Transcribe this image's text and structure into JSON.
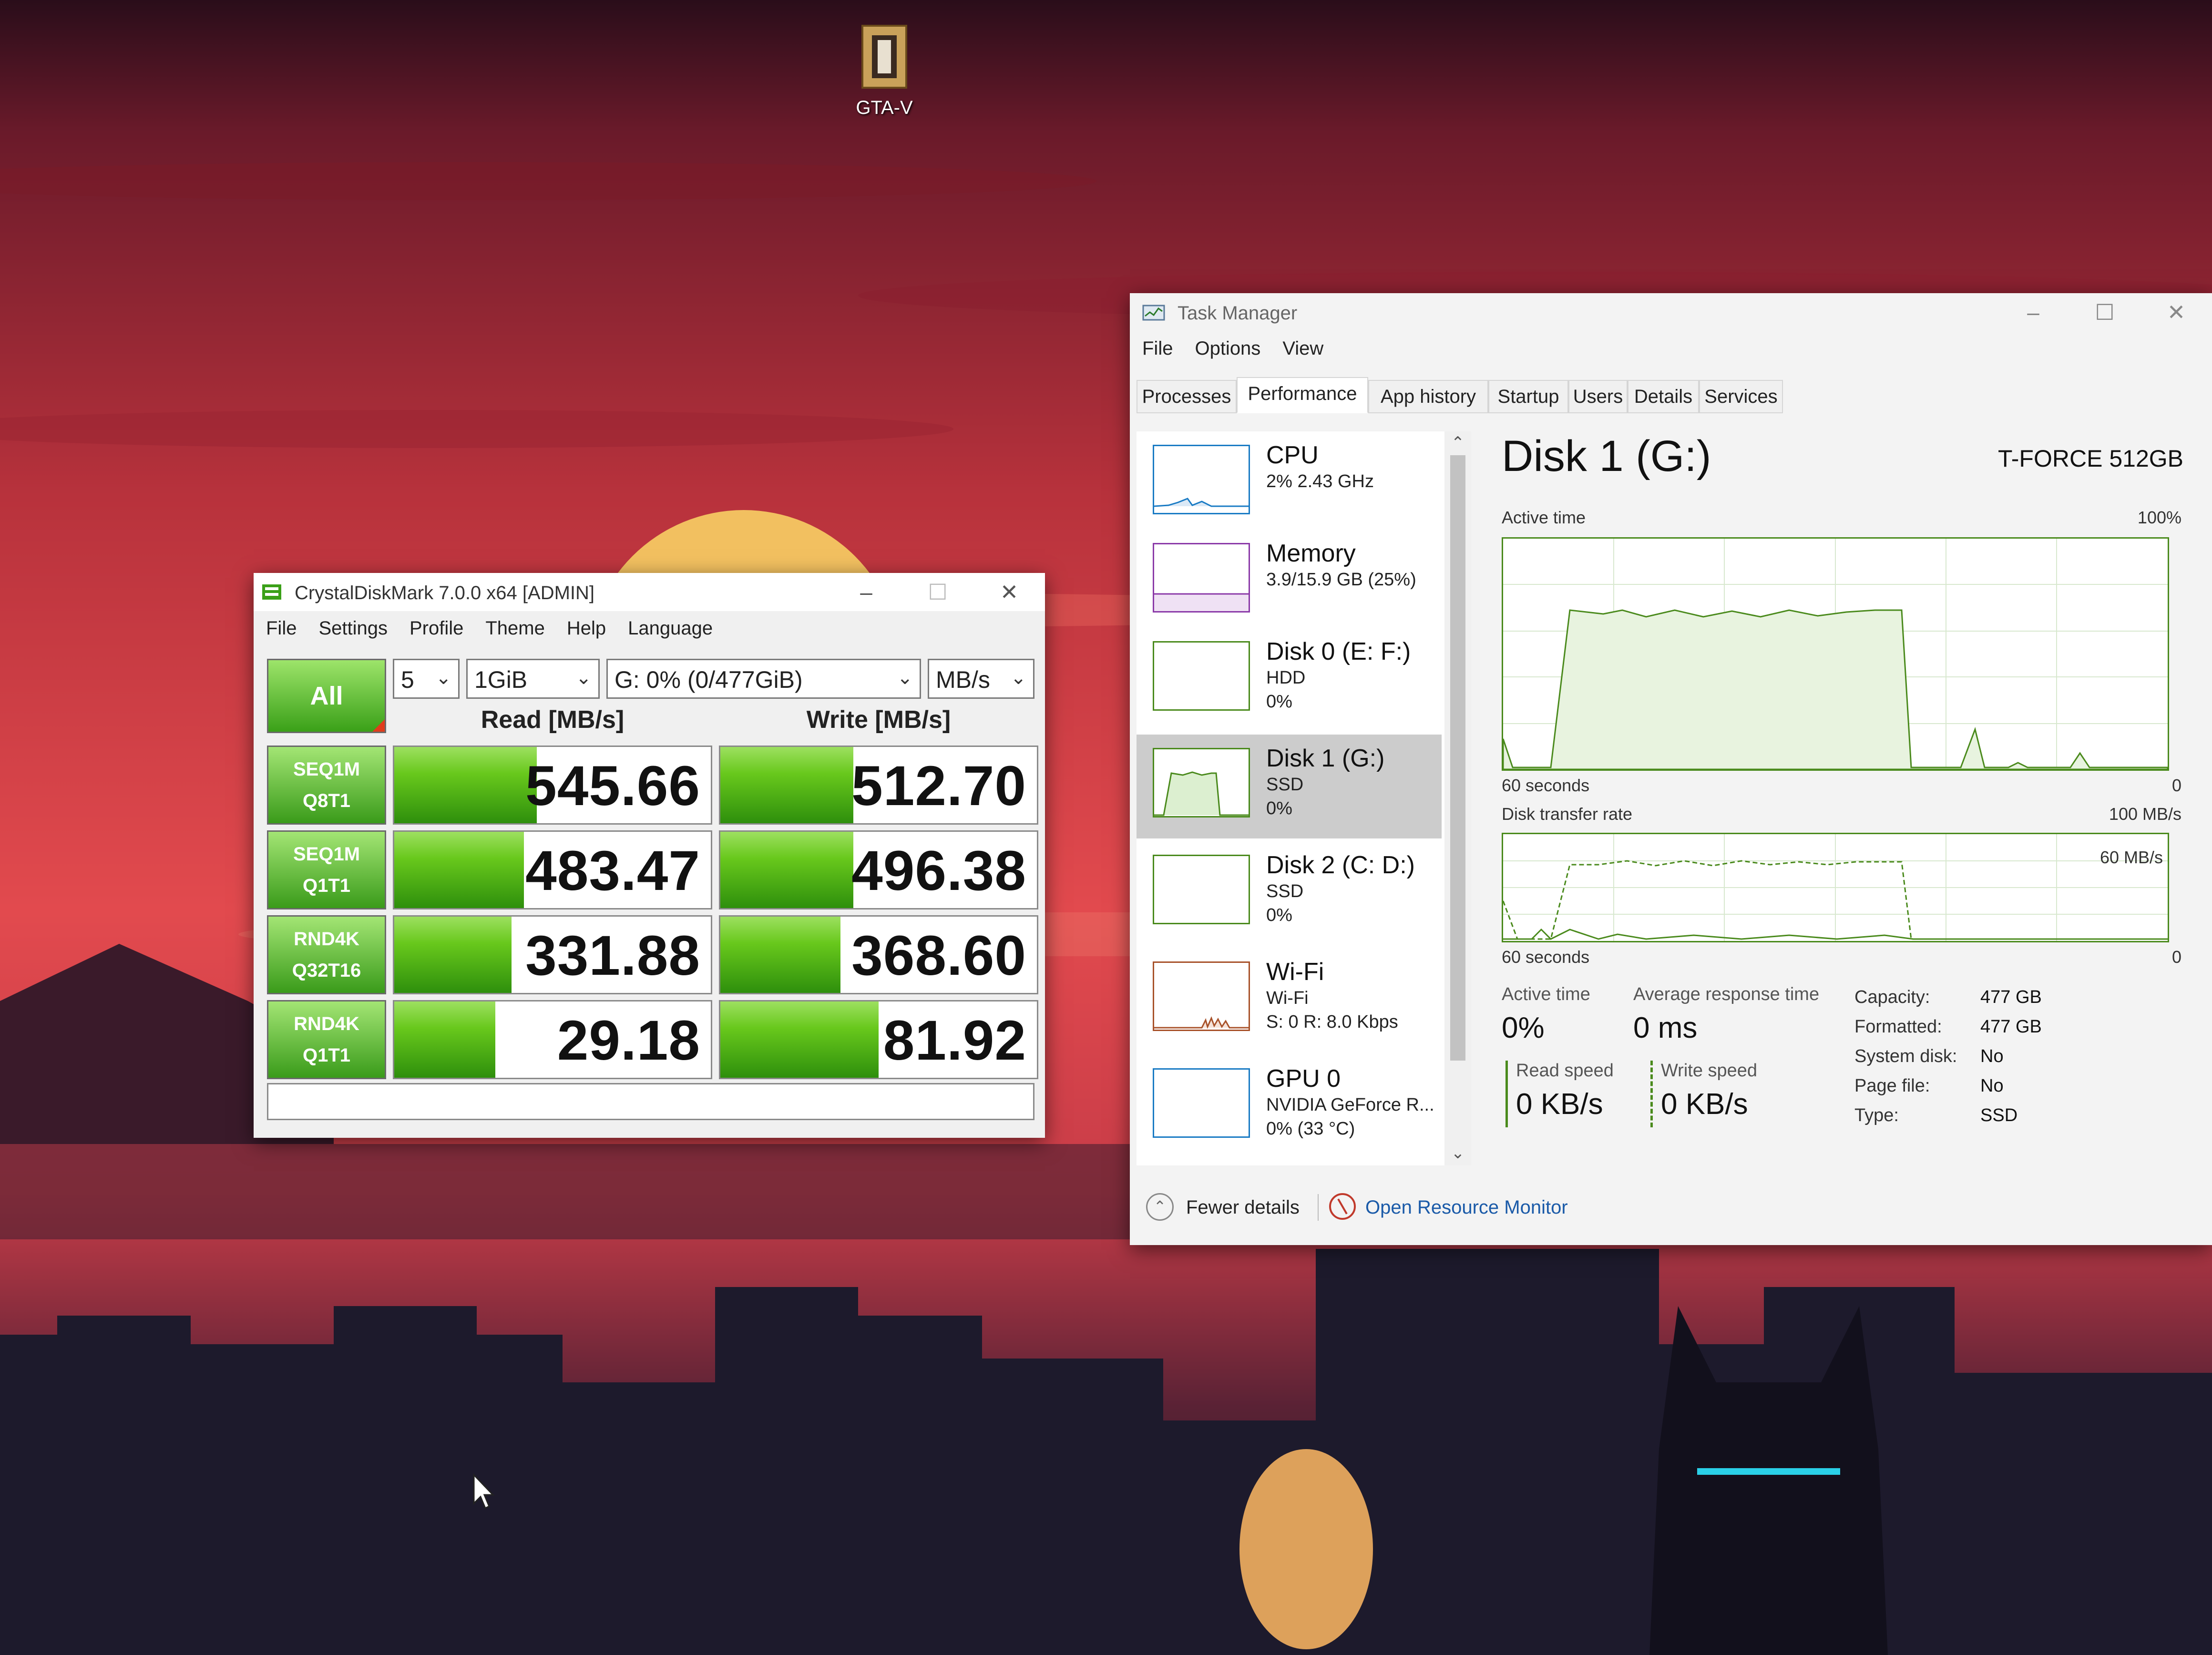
{
  "desktop": {
    "icon_label": "GTA-V"
  },
  "crystaldiskmark": {
    "title": "CrystalDiskMark 7.0.0 x64 [ADMIN]",
    "menu": [
      "File",
      "Settings",
      "Profile",
      "Theme",
      "Help",
      "Language"
    ],
    "all_button": "All",
    "count": "5",
    "size": "1GiB",
    "drive": "G: 0% (0/477GiB)",
    "unit": "MB/s",
    "read_header": "Read [MB/s]",
    "write_header": "Write [MB/s]",
    "rows": [
      {
        "line1": "SEQ1M",
        "line2": "Q8T1",
        "read": "545.66",
        "write": "512.70",
        "read_fill": 0.45,
        "write_fill": 0.42
      },
      {
        "line1": "SEQ1M",
        "line2": "Q1T1",
        "read": "483.47",
        "write": "496.38",
        "read_fill": 0.41,
        "write_fill": 0.42
      },
      {
        "line1": "RND4K",
        "line2": "Q32T16",
        "read": "331.88",
        "write": "368.60",
        "read_fill": 0.37,
        "write_fill": 0.38
      },
      {
        "line1": "RND4K",
        "line2": "Q1T1",
        "read": "29.18",
        "write": "81.92",
        "read_fill": 0.32,
        "write_fill": 0.5
      }
    ],
    "colors": {
      "accent": "#48b01c"
    }
  },
  "taskmanager": {
    "title": "Task Manager",
    "menu": [
      "File",
      "Options",
      "View"
    ],
    "tabs": [
      "Processes",
      "Performance",
      "App history",
      "Startup",
      "Users",
      "Details",
      "Services"
    ],
    "active_tab": "Performance",
    "sidebar": [
      {
        "name": "CPU",
        "line2": "2% 2.43 GHz",
        "line3": "",
        "color": "#1a7bc4"
      },
      {
        "name": "Memory",
        "line2": "3.9/15.9 GB (25%)",
        "line3": "",
        "color": "#8b3aa8"
      },
      {
        "name": "Disk 0 (E: F:)",
        "line2": "HDD",
        "line3": "0%",
        "color": "#4a8a1c"
      },
      {
        "name": "Disk 1 (G:)",
        "line2": "SSD",
        "line3": "0%",
        "color": "#4a8a1c"
      },
      {
        "name": "Disk 2 (C: D:)",
        "line2": "SSD",
        "line3": "0%",
        "color": "#4a8a1c"
      },
      {
        "name": "Wi-Fi",
        "line2": "Wi-Fi",
        "line3": "S: 0 R: 8.0 Kbps",
        "color": "#a8522a"
      },
      {
        "name": "GPU 0",
        "line2": "NVIDIA GeForce R...",
        "line3": "0% (33 °C)",
        "color": "#1a7bc4"
      }
    ],
    "selected_index": 3,
    "detail": {
      "title": "Disk 1 (G:)",
      "model": "T-FORCE 512GB",
      "active_time_label": "Active time",
      "active_time_max": "100%",
      "seconds_label": "60 seconds",
      "zero": "0",
      "transfer_label": "Disk transfer rate",
      "transfer_max": "100 MB/s",
      "transfer_mid": "60 MB/s",
      "stats": {
        "active_time_label": "Active time",
        "active_time_value": "0%",
        "avg_response_label": "Average response time",
        "avg_response_value": "0 ms",
        "read_speed_label": "Read speed",
        "read_speed_value": "0 KB/s",
        "write_speed_label": "Write speed",
        "write_speed_value": "0 KB/s"
      },
      "properties": [
        {
          "label": "Capacity:",
          "value": "477 GB"
        },
        {
          "label": "Formatted:",
          "value": "477 GB"
        },
        {
          "label": "System disk:",
          "value": "No"
        },
        {
          "label": "Page file:",
          "value": "No"
        },
        {
          "label": "Type:",
          "value": "SSD"
        }
      ]
    },
    "footer": {
      "fewer_details": "Fewer details",
      "open_resource_monitor": "Open Resource Monitor"
    }
  }
}
